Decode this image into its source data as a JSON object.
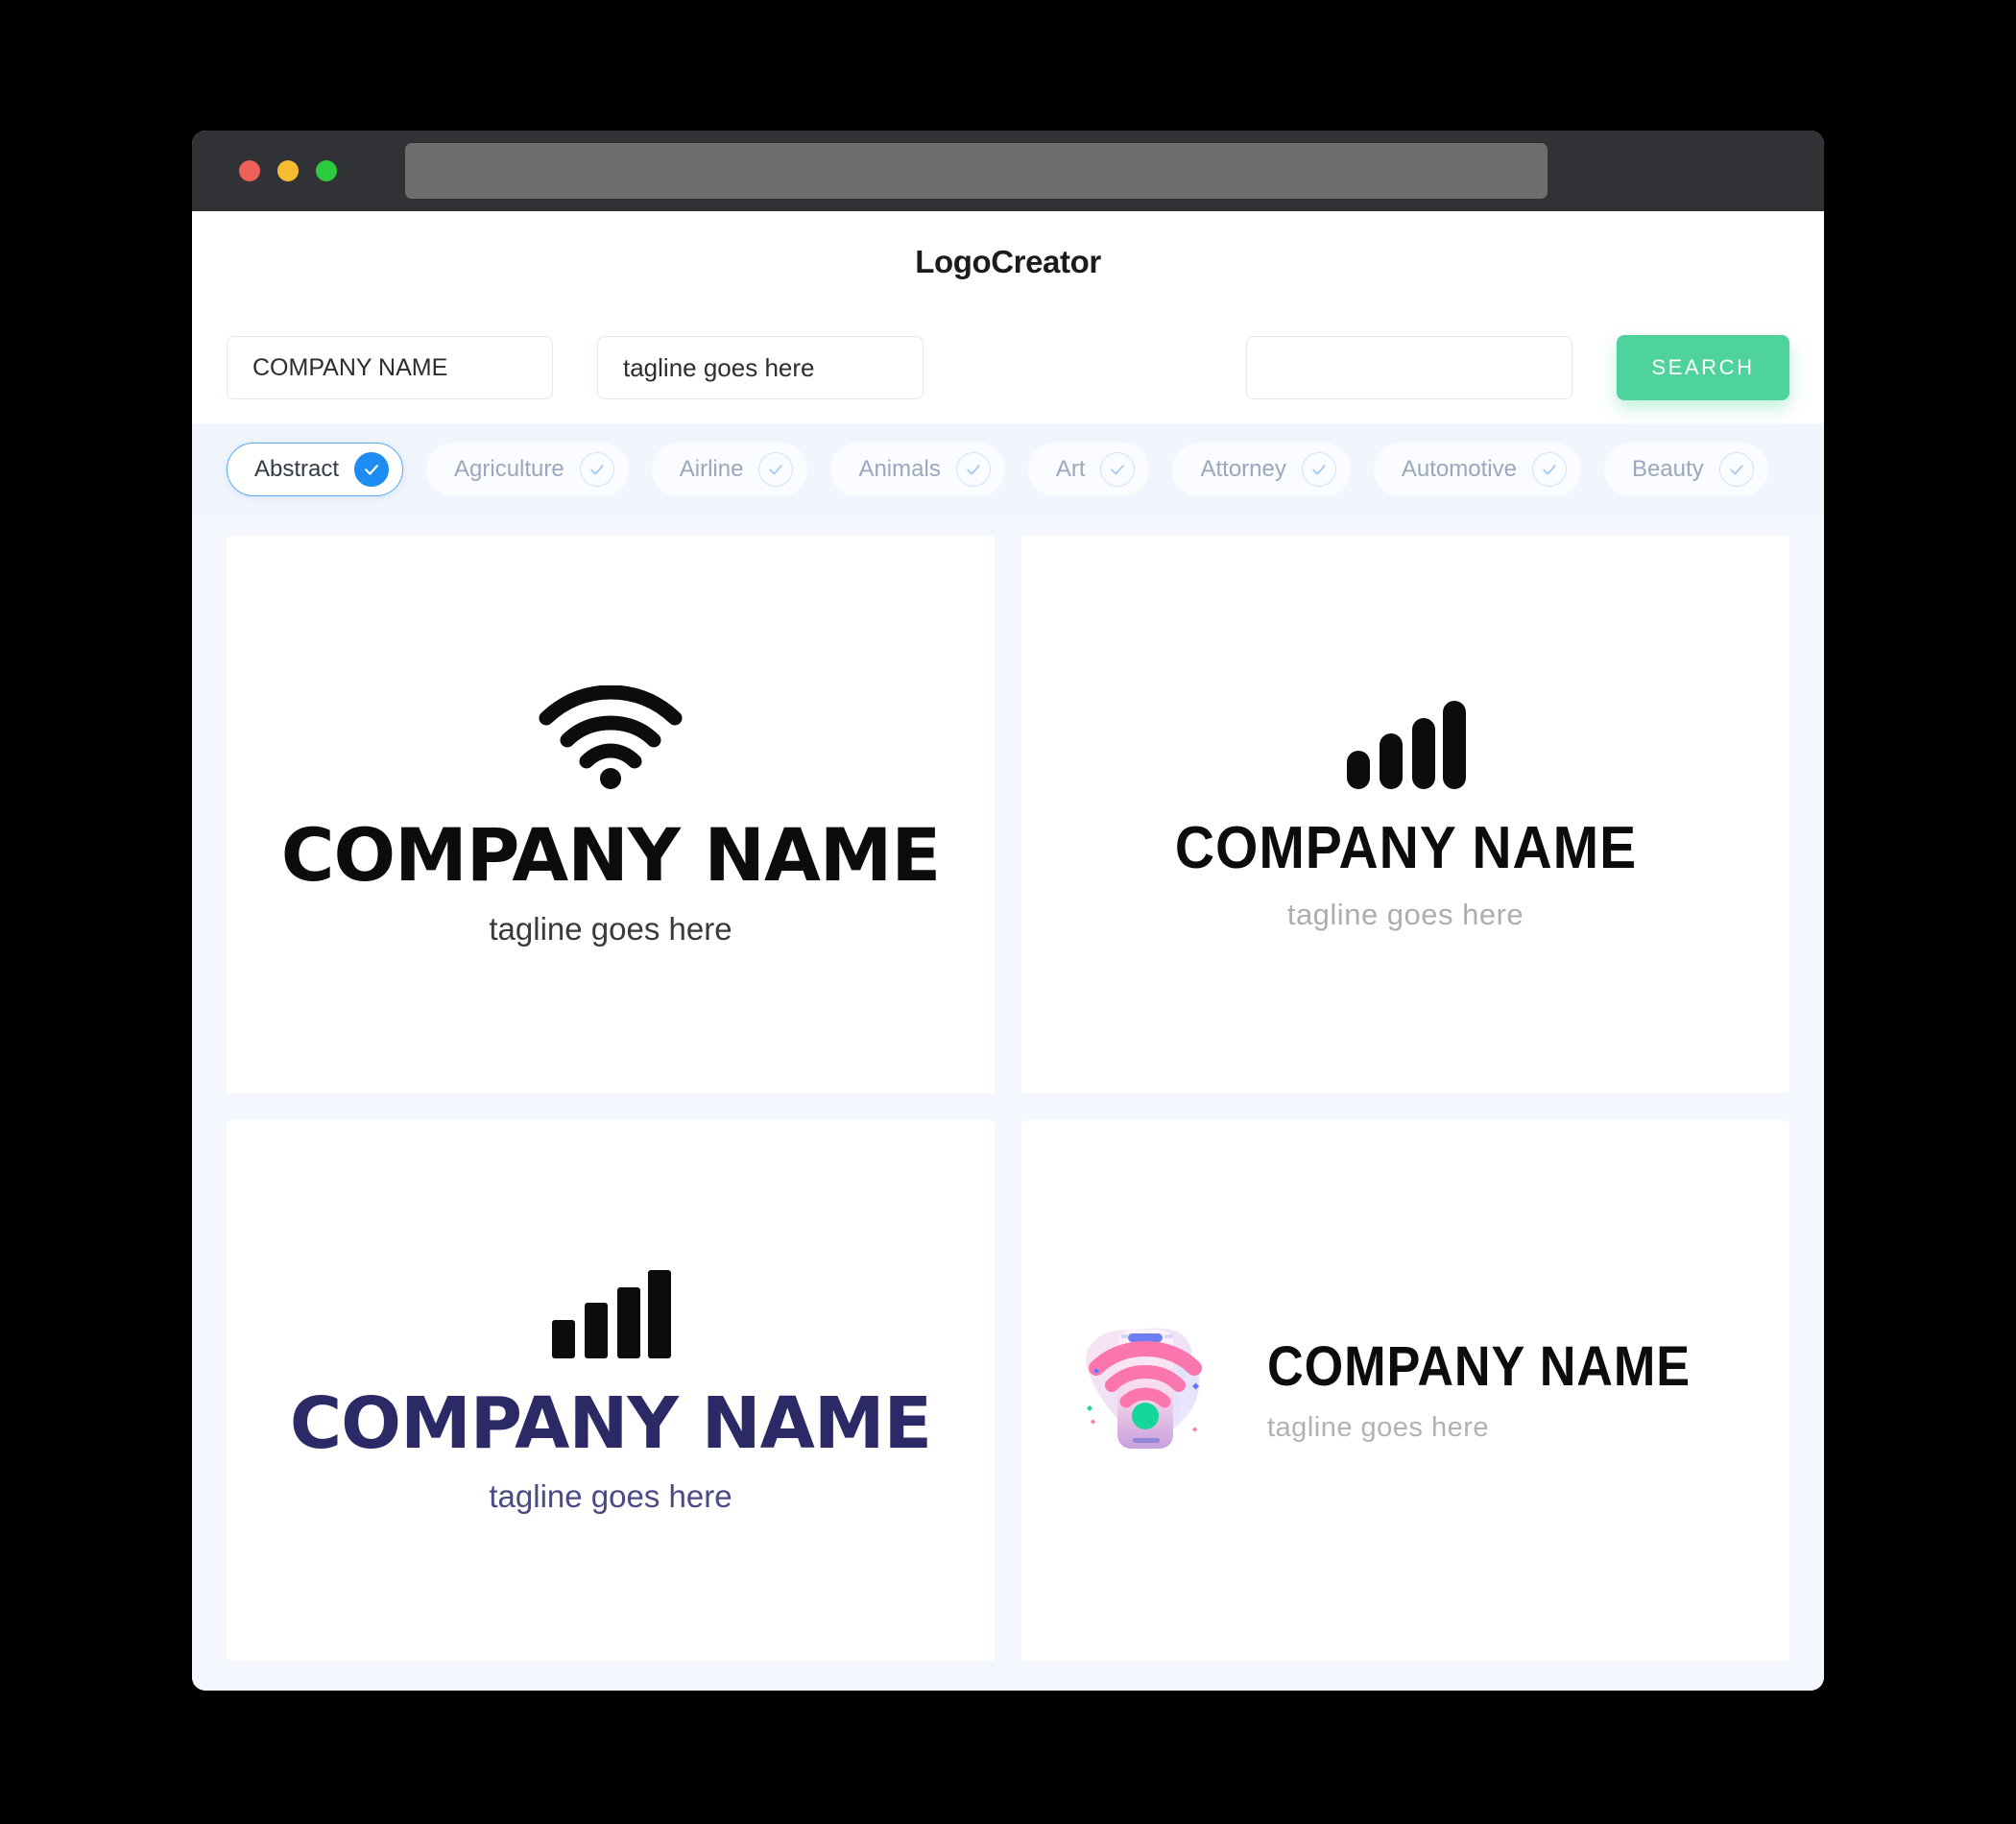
{
  "window": {
    "traffic_lights": [
      "close",
      "minimize",
      "maximize"
    ],
    "url_value": ""
  },
  "header": {
    "title": "LogoCreator"
  },
  "search": {
    "company_value": "COMPANY NAME",
    "company_placeholder": "COMPANY NAME",
    "tagline_value": "tagline goes here",
    "tagline_placeholder": "tagline goes here",
    "extra_value": "",
    "extra_placeholder": "",
    "button_label": "SEARCH",
    "button_color": "#4dd39b"
  },
  "categories": {
    "selected": "Abstract",
    "accent": "#1d8df3",
    "items": [
      {
        "label": "Abstract",
        "selected": true
      },
      {
        "label": "Agriculture",
        "selected": false
      },
      {
        "label": "Airline",
        "selected": false
      },
      {
        "label": "Animals",
        "selected": false
      },
      {
        "label": "Art",
        "selected": false
      },
      {
        "label": "Attorney",
        "selected": false
      },
      {
        "label": "Automotive",
        "selected": false
      },
      {
        "label": "Beauty",
        "selected": false
      }
    ],
    "next_icon": "arrow-right-icon"
  },
  "results": [
    {
      "icon": "wifi-icon",
      "name": "COMPANY NAME",
      "tagline": "tagline goes here",
      "name_color": "#0c0c0c",
      "tagline_color": "#3a3a3a"
    },
    {
      "icon": "signal-bars-icon",
      "name": "COMPANY NAME",
      "tagline": "tagline goes here",
      "name_color": "#0c0c0c",
      "tagline_color": "#adadad"
    },
    {
      "icon": "signal-bars-square-icon",
      "name": "COMPANY NAME",
      "tagline": "tagline goes here",
      "name_color": "#2c2a66",
      "tagline_color": "#4b4a84"
    },
    {
      "icon": "phone-wifi-illustration-icon",
      "name": "COMPANY NAME",
      "tagline": "tagline goes here",
      "name_color": "#0c0c0c",
      "tagline_color": "#b2b2b2"
    }
  ]
}
